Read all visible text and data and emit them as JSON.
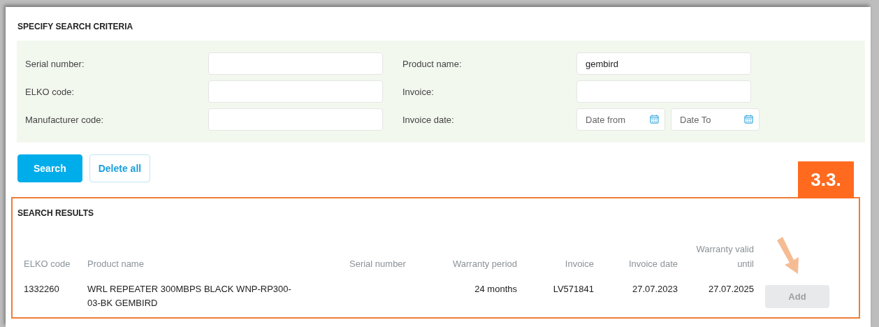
{
  "criteria": {
    "title": "SPECIFY SEARCH CRITERIA",
    "fields": [
      {
        "label": "Serial number:",
        "kind": "text"
      },
      {
        "label": "Product name:",
        "kind": "text",
        "value": "gembird"
      },
      {
        "label": "ELKO code:",
        "kind": "text"
      },
      {
        "label": "Invoice:",
        "kind": "text"
      },
      {
        "label": "Manufacturer code:",
        "kind": "text"
      },
      {
        "label": "Invoice date:",
        "kind": "daterange",
        "from_placeholder": "Date from",
        "to_placeholder": "Date To"
      }
    ]
  },
  "buttons": [
    {
      "label": "Search",
      "kind": "primary"
    },
    {
      "label": "Delete all",
      "kind": "secondary"
    }
  ],
  "badge": "3.3.",
  "results": {
    "title": "SEARCH RESULTS",
    "columns": [
      "ELKO code",
      "Product name",
      "Serial number",
      "Warranty period",
      "Invoice",
      "Invoice date",
      "Warranty valid until"
    ],
    "rows": [
      {
        "cells": [
          "1332260",
          "WRL REPEATER 300MBPS BLACK WNP-RP300-03-BK GEMBIRD",
          "",
          "24 months",
          "LV571841",
          "27.07.2023",
          "27.07.2025"
        ],
        "action": {
          "label": "Add",
          "disabled": true
        }
      }
    ]
  }
}
